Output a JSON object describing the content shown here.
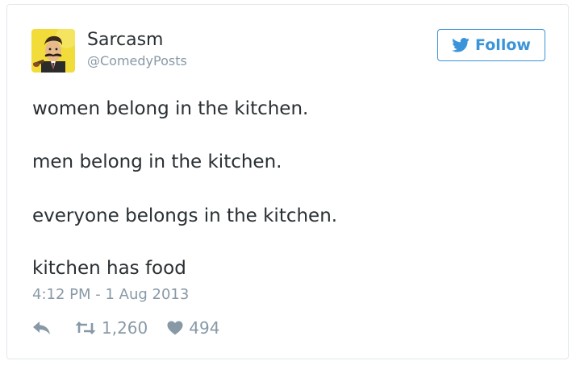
{
  "user": {
    "name": "Sarcasm",
    "handle": "@ComedyPosts",
    "avatar_icon": "mustache-man-avatar"
  },
  "follow_button": {
    "label": "Follow",
    "icon": "twitter-bird-icon",
    "color": "#3b94d9"
  },
  "tweet": {
    "lines": [
      "women belong in the kitchen.",
      "men belong in the kitchen.",
      "everyone belongs in the kitchen.",
      "kitchen has food"
    ],
    "timestamp": "4:12 PM - 1 Aug 2013"
  },
  "actions": {
    "reply_icon": "reply-icon",
    "retweet_icon": "retweet-icon",
    "retweet_count": "1,260",
    "like_icon": "heart-icon",
    "like_count": "494"
  },
  "colors": {
    "text": "#292f33",
    "muted": "#8899a6",
    "border": "#e1e8ed"
  }
}
